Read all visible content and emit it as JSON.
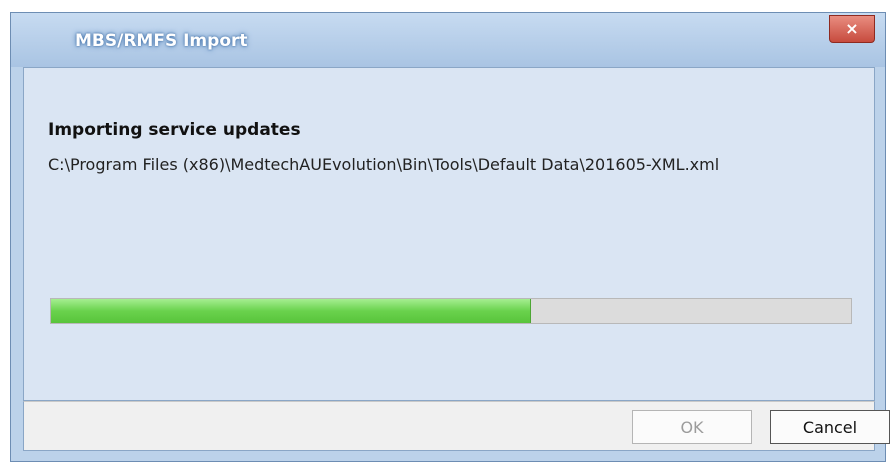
{
  "window": {
    "title": "MBS/RMFS Import",
    "close_label": "×"
  },
  "content": {
    "heading": "Importing service updates",
    "path_text": "C:\\Program Files (x86)\\MedtechAUEvolution\\Bin\\Tools\\Default Data\\201605-XML.xml"
  },
  "progress": {
    "value_percent": 60,
    "fill_color": "#6ad24d"
  },
  "buttons": {
    "ok_label": "OK",
    "ok_enabled": false,
    "cancel_label": "Cancel"
  },
  "colors": {
    "accent": "#bcd2ea",
    "close_button": "#c74b3e"
  }
}
